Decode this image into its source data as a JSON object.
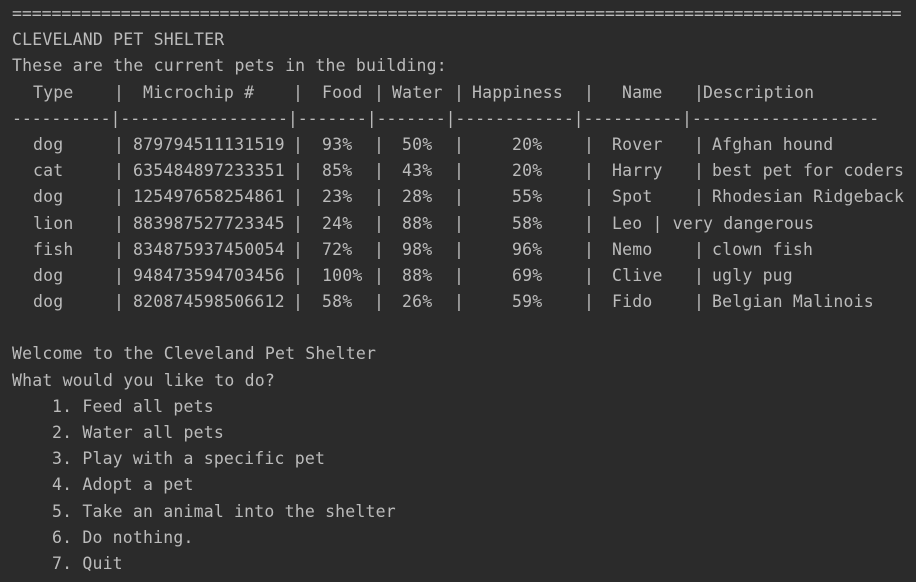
{
  "console": {
    "separator": "==========================================================================================",
    "title": "CLEVELAND PET SHELTER",
    "intro": "These are the current pets in the building:",
    "columns": {
      "type": "Type",
      "microchip": "Microchip #",
      "food": "Food",
      "water": "Water",
      "happiness": "Happiness",
      "name": "Name",
      "description": "Description"
    },
    "pipe": "|",
    "dash_rule": "----------|-----------------|-------|-------|------------|----------|-------------------",
    "rows": [
      {
        "type": "dog",
        "chip": "879794511131519",
        "food": "93%",
        "water": "50%",
        "happiness": "20%",
        "name": "Rover",
        "description": "Afghan hound"
      },
      {
        "type": "cat",
        "chip": "635484897233351",
        "food": "85%",
        "water": "43%",
        "happiness": "20%",
        "name": "Harry",
        "description": "best pet for coders"
      },
      {
        "type": "dog",
        "chip": "125497658254861",
        "food": "23%",
        "water": "28%",
        "happiness": "55%",
        "name": "Spot",
        "description": "Rhodesian Ridgeback"
      },
      {
        "type": "lion",
        "chip": "883987527723345",
        "food": "24%",
        "water": "88%",
        "happiness": "58%",
        "name": "Leo | very dangerous",
        "description": ""
      },
      {
        "type": "fish",
        "chip": "834875937450054",
        "food": "72%",
        "water": "98%",
        "happiness": "96%",
        "name": "Nemo",
        "description": "clown fish"
      },
      {
        "type": "dog",
        "chip": "948473594703456",
        "food": "100%",
        "water": "88%",
        "happiness": "69%",
        "name": "Clive",
        "description": "ugly pug"
      },
      {
        "type": "dog",
        "chip": "820874598506612",
        "food": "58%",
        "water": "26%",
        "happiness": "59%",
        "name": "Fido",
        "description": "Belgian Malinois"
      }
    ],
    "welcome": "Welcome to the Cleveland Pet Shelter",
    "prompt": "What would you like to do?",
    "menu": [
      "1. Feed all pets",
      "2. Water all pets",
      "3. Play with a specific pet",
      "4. Adopt a pet",
      "5. Take an animal into the shelter",
      "6. Do nothing.",
      "7. Quit"
    ]
  }
}
